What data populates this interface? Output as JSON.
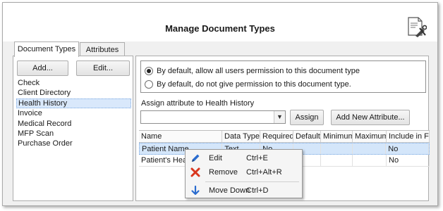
{
  "window": {
    "title": "Manage Document Types"
  },
  "tabs": [
    {
      "label": "Document Types",
      "active": true
    },
    {
      "label": "Attributes",
      "active": false
    }
  ],
  "left": {
    "add_label": "Add...",
    "edit_label": "Edit...",
    "document_types": [
      "Check",
      "Client Directory",
      "Health History",
      "Invoice",
      "Medical Record",
      "MFP Scan",
      "Purchase Order"
    ],
    "selected_index": 2
  },
  "permissions": {
    "option_allow": "By default, allow all users permission to this document type",
    "option_deny": "By default, do not give permission to this document type.",
    "selected": "allow"
  },
  "assign": {
    "label": "Assign attribute to Health History",
    "select_value": "",
    "assign_label": "Assign",
    "add_new_label": "Add New Attribute..."
  },
  "grid": {
    "columns": [
      "Name",
      "Data Type",
      "Required",
      "Default",
      "Minimum",
      "Maximum",
      "Include in File"
    ],
    "rows": [
      {
        "name": "Patient Name",
        "type": "Text",
        "required": "No",
        "default": "",
        "min": "",
        "max": "",
        "include": "No"
      },
      {
        "name": "Patient's Health",
        "type": "",
        "required": "",
        "default": "",
        "min": "",
        "max": "",
        "include": "No"
      }
    ]
  },
  "context_menu": {
    "items": [
      {
        "label": "Edit",
        "shortcut": "Ctrl+E",
        "icon": "pencil-icon"
      },
      {
        "label": "Remove",
        "shortcut": "Ctrl+Alt+R",
        "icon": "red-x-icon"
      },
      {
        "label": "Move Down",
        "shortcut": "Ctrl+D",
        "icon": "arrow-down-icon"
      }
    ]
  },
  "colors": {
    "selection": "#d9e8fb",
    "accent": "#2a6ccf",
    "remove": "#d9361e"
  }
}
